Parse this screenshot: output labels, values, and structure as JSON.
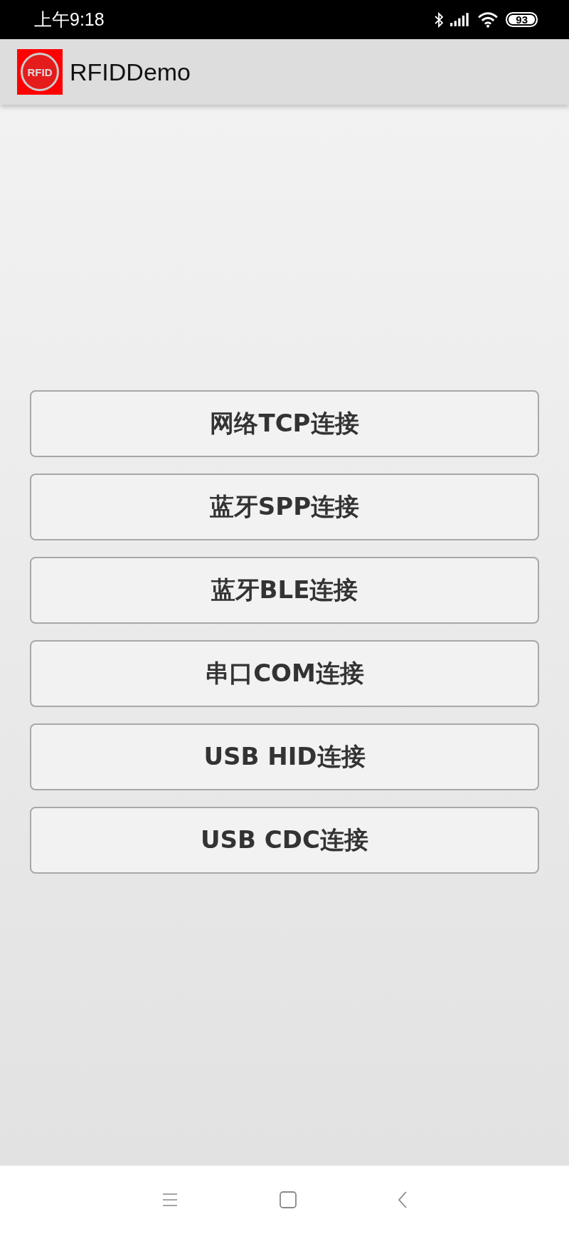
{
  "status_bar": {
    "time": "上午9:18",
    "battery": "93"
  },
  "app_bar": {
    "logo_text": "RFID",
    "title": "RFIDDemo"
  },
  "buttons": [
    {
      "label": "网络TCP连接"
    },
    {
      "label": "蓝牙SPP连接"
    },
    {
      "label": "蓝牙BLE连接"
    },
    {
      "label": "串口COM连接"
    },
    {
      "label": "USB HID连接"
    },
    {
      "label": "USB CDC连接"
    }
  ]
}
